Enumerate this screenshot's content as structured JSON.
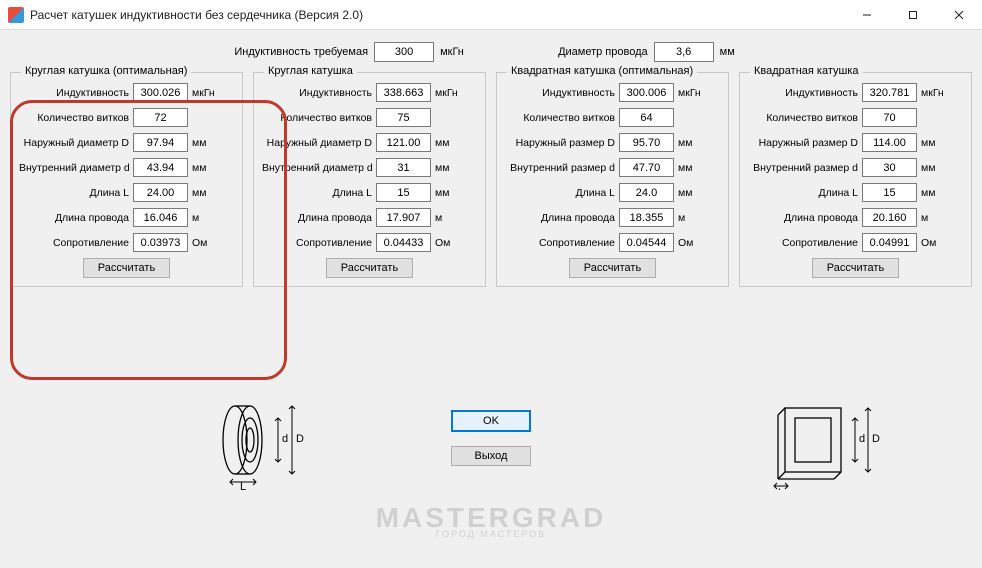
{
  "window": {
    "title": "Расчет катушек индуктивности без сердечника (Версия 2.0)"
  },
  "top": {
    "inductance_label": "Индуктивность требуемая",
    "inductance_value": "300",
    "inductance_unit": "мкГн",
    "wire_diam_label": "Диаметр провода",
    "wire_diam_value": "3,6",
    "wire_diam_unit": "мм"
  },
  "panels": [
    {
      "title": "Круглая катушка (оптимальная)",
      "rows": [
        {
          "label": "Индуктивность",
          "value": "300.026",
          "unit": "мкГн"
        },
        {
          "label": "Количество витков",
          "value": "72",
          "unit": ""
        },
        {
          "label": "Наружный диаметр D",
          "value": "97.94",
          "unit": "мм"
        },
        {
          "label": "Внутренний диаметр d",
          "value": "43.94",
          "unit": "мм"
        },
        {
          "label": "Длина L",
          "value": "24.00",
          "unit": "мм"
        },
        {
          "label": "Длина провода",
          "value": "16.046",
          "unit": "м"
        },
        {
          "label": "Сопротивление",
          "value": "0.03973",
          "unit": "Ом"
        }
      ],
      "button": "Рассчитать"
    },
    {
      "title": "Круглая катушка",
      "rows": [
        {
          "label": "Индуктивность",
          "value": "338.663",
          "unit": "мкГн"
        },
        {
          "label": "Количество витков",
          "value": "75",
          "unit": ""
        },
        {
          "label": "Наружный диаметр D",
          "value": "121.00",
          "unit": "мм"
        },
        {
          "label": "Внутренний диаметр d",
          "value": "31",
          "unit": "мм"
        },
        {
          "label": "Длина L",
          "value": "15",
          "unit": "мм"
        },
        {
          "label": "Длина провода",
          "value": "17.907",
          "unit": "м"
        },
        {
          "label": "Сопротивление",
          "value": "0.04433",
          "unit": "Ом"
        }
      ],
      "button": "Рассчитать"
    },
    {
      "title": "Квадратная катушка (оптимальная)",
      "rows": [
        {
          "label": "Индуктивность",
          "value": "300.006",
          "unit": "мкГн"
        },
        {
          "label": "Количество витков",
          "value": "64",
          "unit": ""
        },
        {
          "label": "Наружный размер D",
          "value": "95.70",
          "unit": "мм"
        },
        {
          "label": "Внутренний размер d",
          "value": "47.70",
          "unit": "мм"
        },
        {
          "label": "Длина L",
          "value": "24.0",
          "unit": "мм"
        },
        {
          "label": "Длина провода",
          "value": "18.355",
          "unit": "м"
        },
        {
          "label": "Сопротивление",
          "value": "0.04544",
          "unit": "Ом"
        }
      ],
      "button": "Рассчитать"
    },
    {
      "title": "Квадратная катушка",
      "rows": [
        {
          "label": "Индуктивность",
          "value": "320.781",
          "unit": "мкГн"
        },
        {
          "label": "Количество витков",
          "value": "70",
          "unit": ""
        },
        {
          "label": "Наружный размер D",
          "value": "114.00",
          "unit": "мм"
        },
        {
          "label": "Внутренний размер d",
          "value": "30",
          "unit": "мм"
        },
        {
          "label": "Длина L",
          "value": "15",
          "unit": "мм"
        },
        {
          "label": "Длина провода",
          "value": "20.160",
          "unit": "м"
        },
        {
          "label": "Сопротивление",
          "value": "0.04991",
          "unit": "Ом"
        }
      ],
      "button": "Рассчитать"
    }
  ],
  "center_buttons": {
    "ok": "OK",
    "exit": "Выход"
  },
  "watermark": {
    "main": "MASTERGRAD",
    "sub": "ГОРОД МАСТЕРОВ"
  },
  "diagram_labels": {
    "d": "d",
    "D": "D",
    "L": "L"
  }
}
